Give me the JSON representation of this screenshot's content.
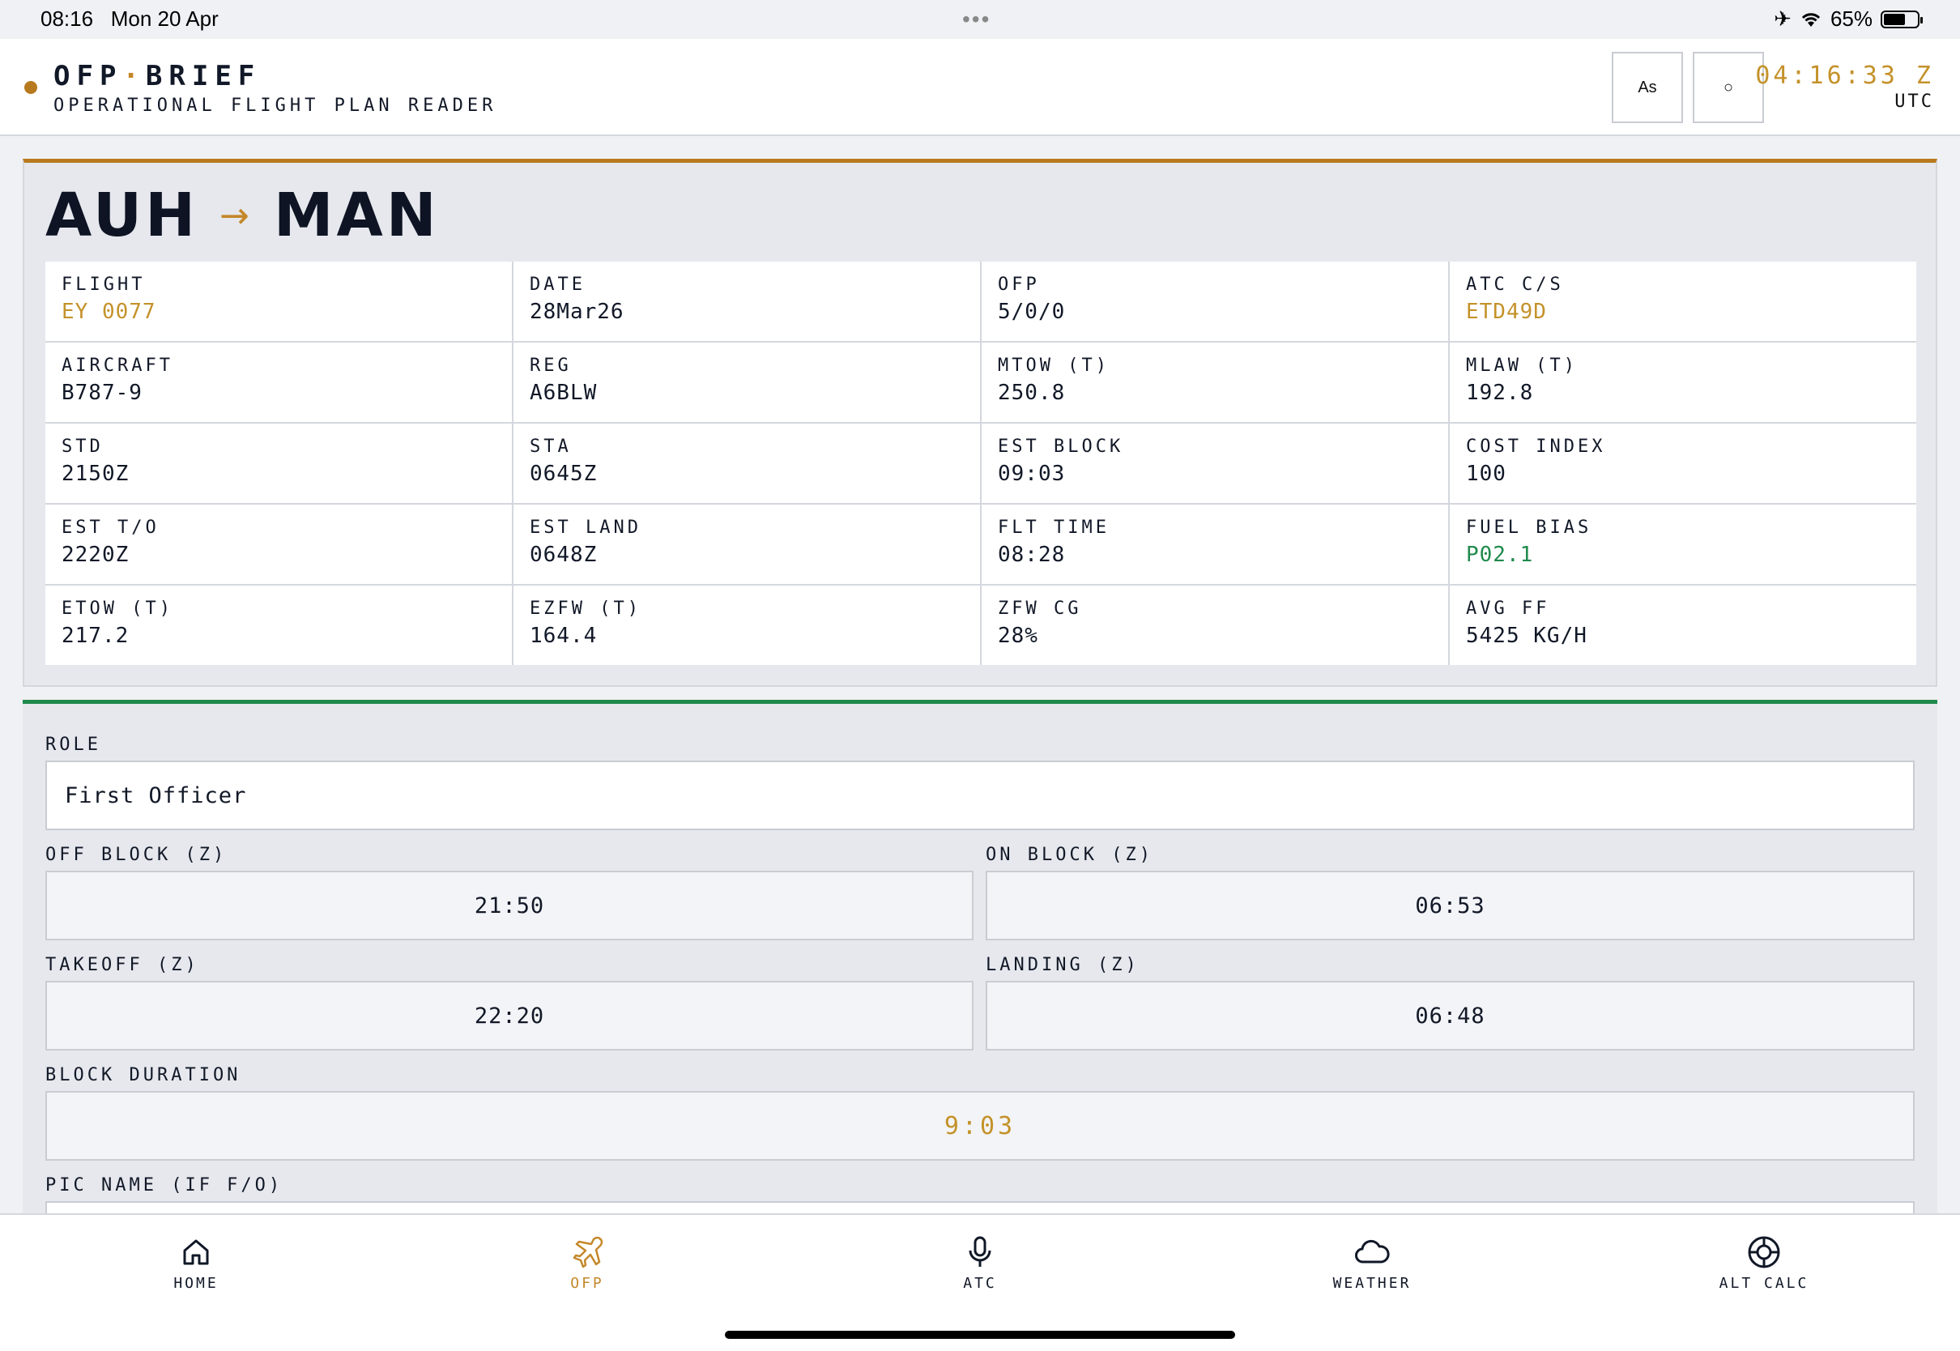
{
  "status_bar": {
    "time": "08:16",
    "date": "Mon 20 Apr",
    "battery": "65%",
    "battery_level": 0.65
  },
  "header": {
    "brand_left": "OFP",
    "brand_sep": "·",
    "brand_right": "BRIEF",
    "subtitle": "OPERATIONAL FLIGHT PLAN READER",
    "btn_text_size": "As",
    "btn_theme": "○",
    "utc_time": "04:16:33 Z",
    "utc_label": "UTC"
  },
  "route": {
    "origin": "AUH",
    "arrow": "→",
    "destination": "MAN"
  },
  "summary": [
    {
      "label": "FLIGHT",
      "value": "EY 0077",
      "color": "#c4922a"
    },
    {
      "label": "DATE",
      "value": "28Mar26",
      "color": "#111827"
    },
    {
      "label": "OFP",
      "value": "5/0/0",
      "color": "#111827"
    },
    {
      "label": "ATC C/S",
      "value": "ETD49D",
      "color": "#c4922a"
    },
    {
      "label": "AIRCRAFT",
      "value": "B787-9",
      "color": "#111827"
    },
    {
      "label": "REG",
      "value": "A6BLW",
      "color": "#111827"
    },
    {
      "label": "MTOW (T)",
      "value": "250.8",
      "color": "#111827"
    },
    {
      "label": "MLAW (T)",
      "value": "192.8",
      "color": "#111827"
    },
    {
      "label": "STD",
      "value": "2150Z",
      "color": "#111827"
    },
    {
      "label": "STA",
      "value": "0645Z",
      "color": "#111827"
    },
    {
      "label": "EST BLOCK",
      "value": "09:03",
      "color": "#111827"
    },
    {
      "label": "COST INDEX",
      "value": "100",
      "color": "#111827"
    },
    {
      "label": "EST T/O",
      "value": "2220Z",
      "color": "#111827"
    },
    {
      "label": "EST LAND",
      "value": "0648Z",
      "color": "#111827"
    },
    {
      "label": "FLT TIME",
      "value": "08:28",
      "color": "#111827"
    },
    {
      "label": "FUEL BIAS",
      "value": "P02.1",
      "color": "#1f8a4c"
    },
    {
      "label": "ETOW (T)",
      "value": "217.2",
      "color": "#111827"
    },
    {
      "label": "EZFW (T)",
      "value": "164.4",
      "color": "#111827"
    },
    {
      "label": "ZFW CG",
      "value": "28%",
      "color": "#111827"
    },
    {
      "label": "AVG FF",
      "value": "5425 KG/H",
      "color": "#111827"
    }
  ],
  "form": {
    "role_label": "ROLE",
    "role_value": "First Officer",
    "off_block_label": "OFF BLOCK (Z)",
    "off_block_value": "21:50",
    "on_block_label": "ON BLOCK (Z)",
    "on_block_value": "06:53",
    "takeoff_label": "TAKEOFF (Z)",
    "takeoff_value": "22:20",
    "landing_label": "LANDING (Z)",
    "landing_value": "06:48",
    "block_duration_label": "BLOCK DURATION",
    "block_duration_value": "9:03",
    "pic_name_label": "PIC NAME (IF F/O)"
  },
  "tabs": [
    {
      "label": "HOME",
      "icon": "home-icon",
      "active": false
    },
    {
      "label": "OFP",
      "icon": "plane-icon",
      "active": true
    },
    {
      "label": "ATC",
      "icon": "microphone-icon",
      "active": false
    },
    {
      "label": "WEATHER",
      "icon": "cloud-icon",
      "active": false
    },
    {
      "label": "ALT CALC",
      "icon": "crosshair-icon",
      "active": false
    }
  ],
  "colors": {
    "accent": "#c4882a",
    "green": "#1f8a4c",
    "ink": "#111827"
  }
}
